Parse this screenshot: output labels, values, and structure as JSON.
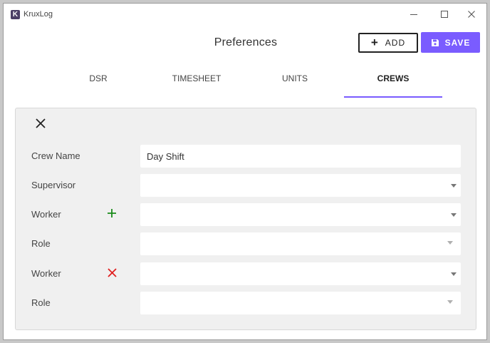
{
  "app": {
    "logo_letter": "K",
    "title": "KruxLog"
  },
  "window_controls": {
    "minimize_icon": "minimize-icon",
    "maximize_icon": "maximize-icon",
    "close_icon": "close-icon"
  },
  "header": {
    "title": "Preferences",
    "add_label": "ADD",
    "save_label": "SAVE"
  },
  "tabs": [
    {
      "label": "DSR",
      "active": false
    },
    {
      "label": "TIMESHEET",
      "active": false
    },
    {
      "label": "UNITS",
      "active": false
    },
    {
      "label": "CREWS",
      "active": true
    }
  ],
  "form": {
    "rows": [
      {
        "label": "Crew Name",
        "value": "Day Shift",
        "type": "text"
      },
      {
        "label": "Supervisor",
        "value": "",
        "type": "select"
      },
      {
        "label": "Worker",
        "value": "",
        "type": "select",
        "action": "add"
      },
      {
        "label": "Role",
        "value": "",
        "type": "select"
      },
      {
        "label": "Worker",
        "value": "",
        "type": "select",
        "action": "remove"
      },
      {
        "label": "Role",
        "value": "",
        "type": "select"
      }
    ]
  },
  "colors": {
    "accent": "#7a5cff",
    "add_icon": "#1a8a1a",
    "remove_icon": "#e02020"
  }
}
